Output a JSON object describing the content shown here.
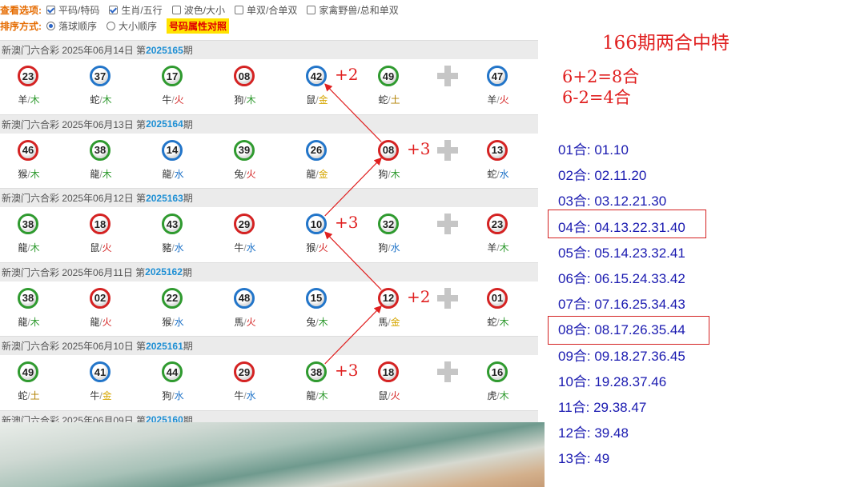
{
  "options": {
    "label_view": "查看选项:",
    "view_opts": [
      {
        "text": "平码/特码",
        "checked": true
      },
      {
        "text": "生肖/五行",
        "checked": true
      },
      {
        "text": "波色/大小",
        "checked": false
      },
      {
        "text": "单双/合单双",
        "checked": false
      },
      {
        "text": "家禽野兽/总和单双",
        "checked": false
      }
    ],
    "label_sort": "排序方式:",
    "sort_opts": [
      {
        "text": "落球顺序",
        "checked": true
      },
      {
        "text": "大小顺序",
        "checked": false
      }
    ],
    "highlight_btn": "号码属性对照"
  },
  "draws": [
    {
      "prefix": "新澳门六合彩 2025年06月14日 第",
      "num": "2025165",
      "suffix": "期",
      "balls": [
        {
          "n": "23",
          "c": "red",
          "z": "羊",
          "e": "木"
        },
        {
          "n": "37",
          "c": "blue",
          "z": "蛇",
          "e": "木"
        },
        {
          "n": "17",
          "c": "green",
          "z": "牛",
          "e": "火"
        },
        {
          "n": "08",
          "c": "red",
          "z": "狗",
          "e": "木"
        },
        {
          "n": "42",
          "c": "blue",
          "z": "鼠",
          "e": "金"
        },
        {
          "n": "49",
          "c": "green",
          "z": "蛇",
          "e": "土"
        },
        {
          "n": "47",
          "c": "blue",
          "z": "羊",
          "e": "火"
        }
      ]
    },
    {
      "prefix": "新澳门六合彩 2025年06月13日 第",
      "num": "2025164",
      "suffix": "期",
      "balls": [
        {
          "n": "46",
          "c": "red",
          "z": "猴",
          "e": "木"
        },
        {
          "n": "38",
          "c": "green",
          "z": "龍",
          "e": "木"
        },
        {
          "n": "14",
          "c": "blue",
          "z": "龍",
          "e": "水"
        },
        {
          "n": "39",
          "c": "green",
          "z": "兔",
          "e": "火"
        },
        {
          "n": "26",
          "c": "blue",
          "z": "龍",
          "e": "金"
        },
        {
          "n": "08",
          "c": "red",
          "z": "狗",
          "e": "木"
        },
        {
          "n": "13",
          "c": "red",
          "z": "蛇",
          "e": "水"
        }
      ]
    },
    {
      "prefix": "新澳门六合彩 2025年06月12日 第",
      "num": "2025163",
      "suffix": "期",
      "balls": [
        {
          "n": "38",
          "c": "green",
          "z": "龍",
          "e": "木"
        },
        {
          "n": "18",
          "c": "red",
          "z": "鼠",
          "e": "火"
        },
        {
          "n": "43",
          "c": "green",
          "z": "豬",
          "e": "水"
        },
        {
          "n": "29",
          "c": "red",
          "z": "牛",
          "e": "水"
        },
        {
          "n": "10",
          "c": "blue",
          "z": "猴",
          "e": "火"
        },
        {
          "n": "32",
          "c": "green",
          "z": "狗",
          "e": "水"
        },
        {
          "n": "23",
          "c": "red",
          "z": "羊",
          "e": "木"
        }
      ]
    },
    {
      "prefix": "新澳门六合彩 2025年06月11日 第",
      "num": "2025162",
      "suffix": "期",
      "balls": [
        {
          "n": "38",
          "c": "green",
          "z": "龍",
          "e": "木"
        },
        {
          "n": "02",
          "c": "red",
          "z": "龍",
          "e": "火"
        },
        {
          "n": "22",
          "c": "green",
          "z": "猴",
          "e": "水"
        },
        {
          "n": "48",
          "c": "blue",
          "z": "馬",
          "e": "火"
        },
        {
          "n": "15",
          "c": "blue",
          "z": "兔",
          "e": "木"
        },
        {
          "n": "12",
          "c": "red",
          "z": "馬",
          "e": "金"
        },
        {
          "n": "01",
          "c": "red",
          "z": "蛇",
          "e": "木"
        }
      ]
    },
    {
      "prefix": "新澳门六合彩 2025年06月10日 第",
      "num": "2025161",
      "suffix": "期",
      "balls": [
        {
          "n": "49",
          "c": "green",
          "z": "蛇",
          "e": "土"
        },
        {
          "n": "41",
          "c": "blue",
          "z": "牛",
          "e": "金"
        },
        {
          "n": "44",
          "c": "green",
          "z": "狗",
          "e": "水"
        },
        {
          "n": "29",
          "c": "red",
          "z": "牛",
          "e": "水"
        },
        {
          "n": "38",
          "c": "green",
          "z": "龍",
          "e": "木"
        },
        {
          "n": "18",
          "c": "red",
          "z": "鼠",
          "e": "火"
        },
        {
          "n": "16",
          "c": "green",
          "z": "虎",
          "e": "木"
        }
      ]
    },
    {
      "prefix": "新澳门六合彩 2025年06月09日 第",
      "num": "2025160",
      "suffix": "期",
      "balls": []
    }
  ],
  "annotations": [
    "+2",
    "+3",
    "+3",
    "+2",
    "+3"
  ],
  "right": {
    "title": "166期两合中特",
    "eq1": "6+2=8合",
    "eq2": "6-2=4合",
    "he_list": [
      "01合: 01.10",
      "02合: 02.11.20",
      "03合: 03.12.21.30",
      "04合: 04.13.22.31.40",
      "05合: 05.14.23.32.41",
      "06合: 06.15.24.33.42",
      "07合: 07.16.25.34.43",
      "08合: 08.17.26.35.44",
      "09合: 09.18.27.36.45",
      "10合: 19.28.37.46",
      "11合: 29.38.47",
      "12合: 39.48",
      "13合: 49"
    ]
  },
  "colors": {
    "red": "#d42222",
    "blue": "#2275c9",
    "green": "#2f9a2f",
    "annotation": "#e02020",
    "he_text": "#1a1ab0"
  }
}
